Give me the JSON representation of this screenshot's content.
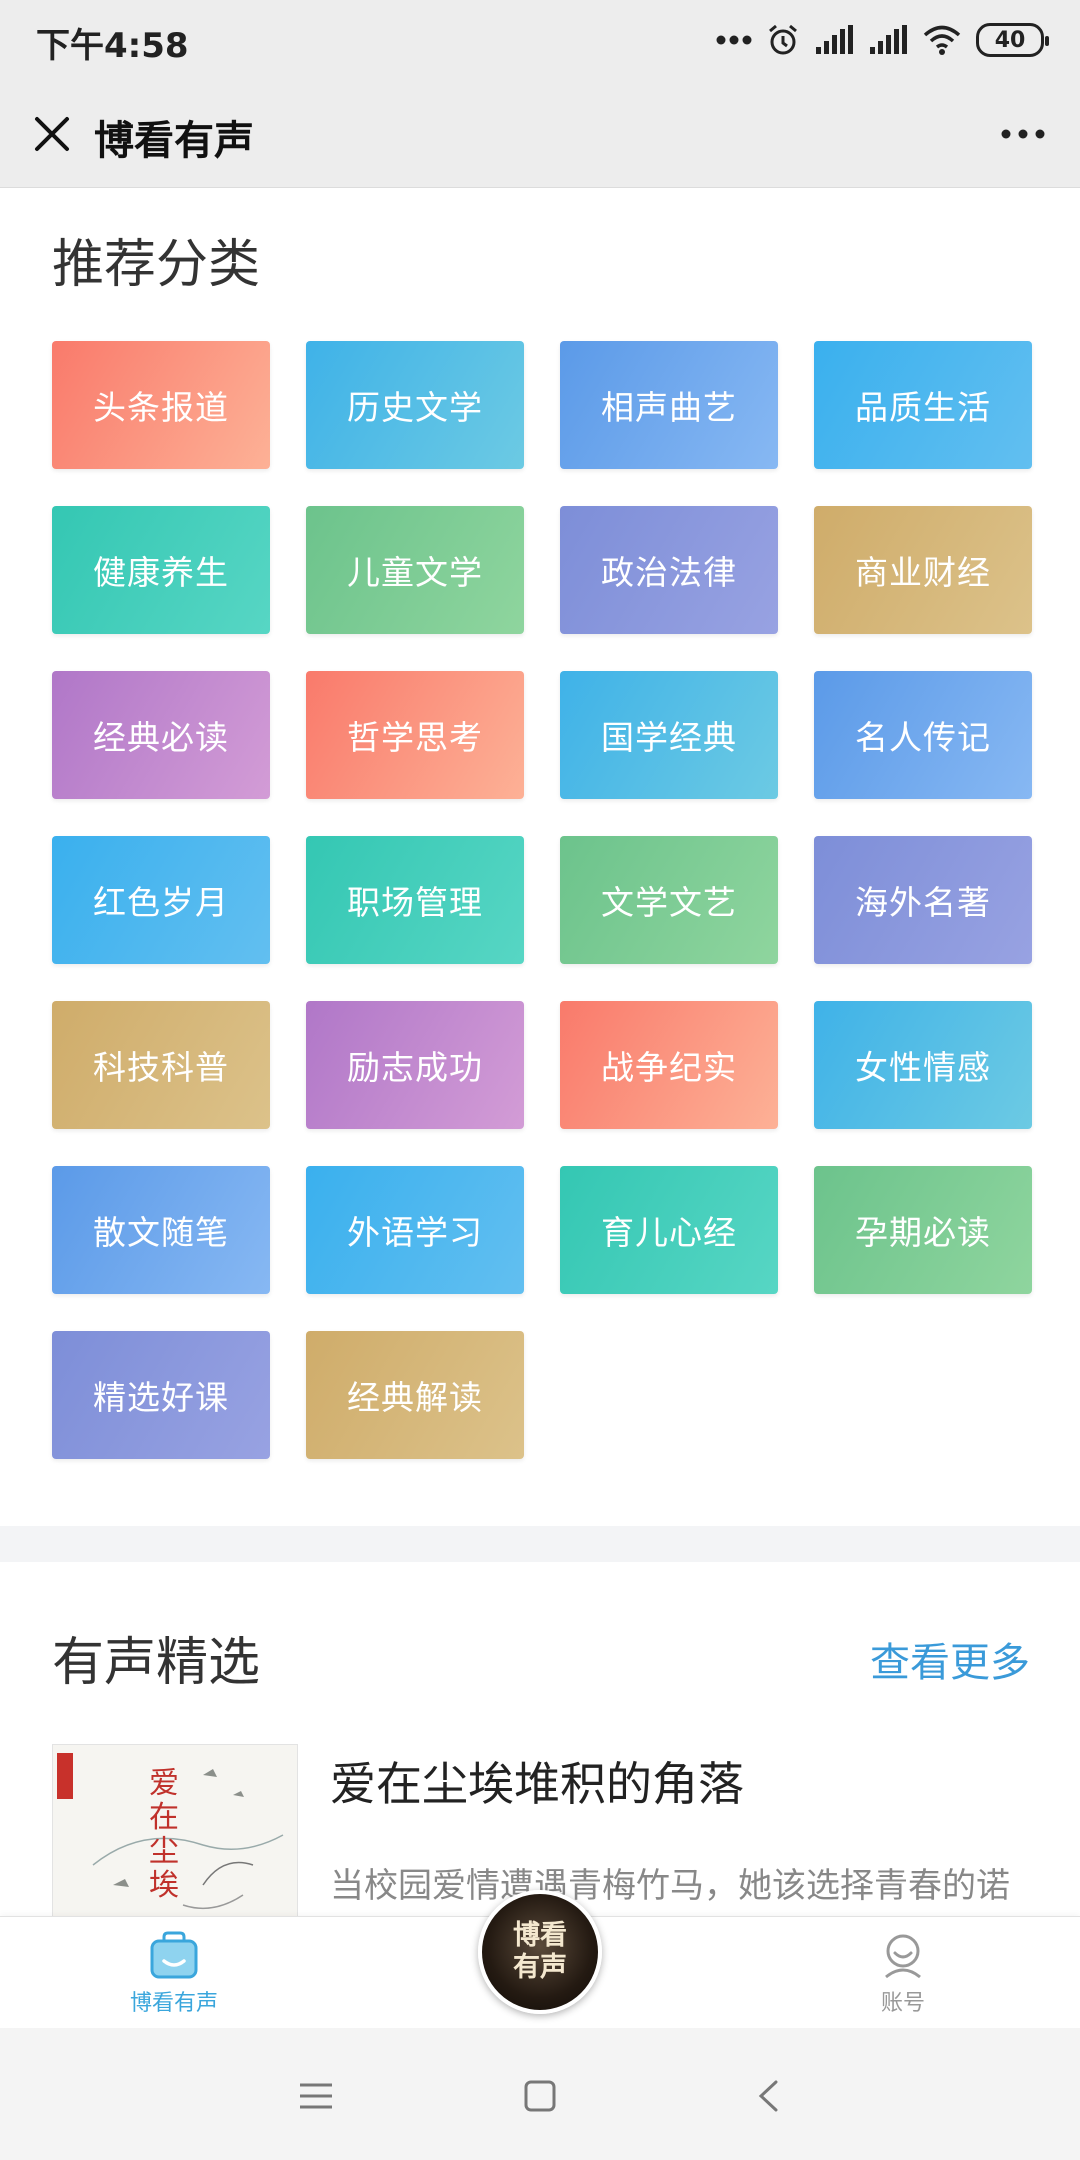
{
  "status_bar": {
    "time": "下午4:58",
    "battery": "40"
  },
  "header": {
    "title": "博看有声",
    "close_icon": "close-icon",
    "more_icon": "more-dots-icon"
  },
  "categories": {
    "heading": "推荐分类",
    "items": [
      {
        "label": "头条报道",
        "color": "coral"
      },
      {
        "label": "历史文学",
        "color": "blue"
      },
      {
        "label": "相声曲艺",
        "color": "sky"
      },
      {
        "label": "品质生活",
        "color": "lblue"
      },
      {
        "label": "健康养生",
        "color": "teal"
      },
      {
        "label": "儿童文学",
        "color": "green"
      },
      {
        "label": "政治法律",
        "color": "purple"
      },
      {
        "label": "商业财经",
        "color": "gold"
      },
      {
        "label": "经典必读",
        "color": "violet"
      },
      {
        "label": "哲学思考",
        "color": "coral"
      },
      {
        "label": "国学经典",
        "color": "blue"
      },
      {
        "label": "名人传记",
        "color": "sky"
      },
      {
        "label": "红色岁月",
        "color": "lblue"
      },
      {
        "label": "职场管理",
        "color": "teal"
      },
      {
        "label": "文学文艺",
        "color": "green"
      },
      {
        "label": "海外名著",
        "color": "purple"
      },
      {
        "label": "科技科普",
        "color": "gold"
      },
      {
        "label": "励志成功",
        "color": "violet"
      },
      {
        "label": "战争纪实",
        "color": "coral"
      },
      {
        "label": "女性情感",
        "color": "blue"
      },
      {
        "label": "散文随笔",
        "color": "sky"
      },
      {
        "label": "外语学习",
        "color": "lblue"
      },
      {
        "label": "育儿心经",
        "color": "teal"
      },
      {
        "label": "孕期必读",
        "color": "green"
      },
      {
        "label": "精选好课",
        "color": "purple"
      },
      {
        "label": "经典解读",
        "color": "gold"
      }
    ]
  },
  "featured": {
    "heading": "有声精选",
    "see_more": "查看更多",
    "book": {
      "title": "爱在尘埃堆积的角落",
      "description": "当校园爱情遭遇青梅竹马，她该选择青春的诺",
      "cover_text": "爱在尘埃"
    }
  },
  "tab_bar": {
    "home_label": "博看有声",
    "center_label": "博看有声",
    "account_label": "账号"
  },
  "colors": {
    "accent": "#3a9ad9",
    "coral": "#f97a6b",
    "blue": "#3fb2e8",
    "sky": "#5b9ae8",
    "lblue": "#3ab0ee",
    "teal": "#34c7b3",
    "green": "#6cc38c",
    "purple": "#7d8ed8",
    "gold": "#cfac6a",
    "violet": "#b077c8"
  }
}
